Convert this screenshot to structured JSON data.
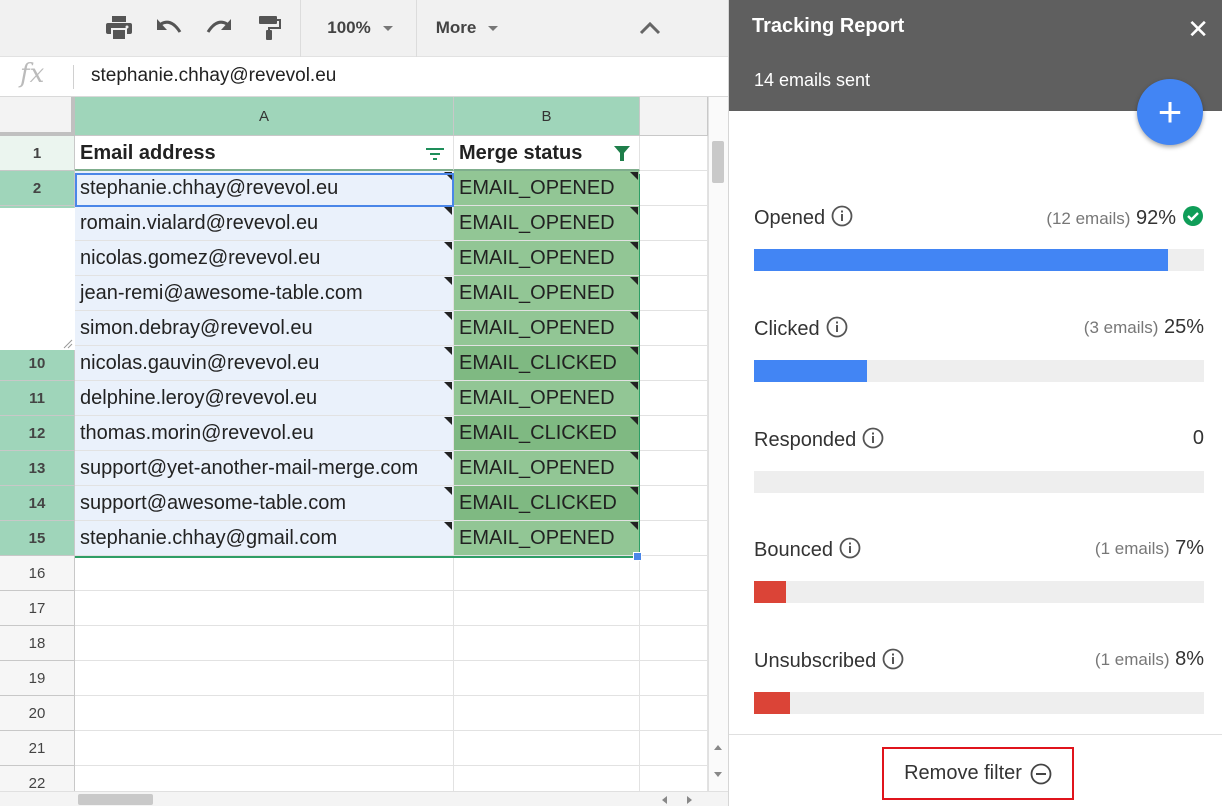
{
  "toolbar": {
    "zoom": "100%",
    "more_label": "More"
  },
  "formula": {
    "fx_label": "fx",
    "value": "stephanie.chhay@revevol.eu"
  },
  "sheet": {
    "columns": [
      "A",
      "B"
    ],
    "header": {
      "row_number": "1",
      "email_header": "Email address",
      "status_header": "Merge status"
    },
    "rows": [
      {
        "num": "2",
        "email": "stephanie.chhay@revevol.eu",
        "status": "EMAIL_OPENED"
      },
      {
        "num": "",
        "email": "romain.vialard@revevol.eu",
        "status": "EMAIL_OPENED"
      },
      {
        "num": "",
        "email": "nicolas.gomez@revevol.eu",
        "status": "EMAIL_OPENED"
      },
      {
        "num": "",
        "email": "jean-remi@awesome-table.com",
        "status": "EMAIL_OPENED"
      },
      {
        "num": "",
        "email": "simon.debray@revevol.eu",
        "status": "EMAIL_OPENED"
      },
      {
        "num": "10",
        "email": "nicolas.gauvin@revevol.eu",
        "status": "EMAIL_CLICKED"
      },
      {
        "num": "11",
        "email": "delphine.leroy@revevol.eu",
        "status": "EMAIL_OPENED"
      },
      {
        "num": "12",
        "email": "thomas.morin@revevol.eu",
        "status": "EMAIL_CLICKED"
      },
      {
        "num": "13",
        "email": "support@yet-another-mail-merge.com",
        "status": "EMAIL_OPENED"
      },
      {
        "num": "14",
        "email": "support@awesome-table.com",
        "status": "EMAIL_CLICKED"
      },
      {
        "num": "15",
        "email": "stephanie.chhay@gmail.com",
        "status": "EMAIL_OPENED"
      }
    ],
    "empty_rows": [
      "16",
      "17",
      "18",
      "19",
      "20",
      "21",
      "22"
    ]
  },
  "report": {
    "title": "Tracking Report",
    "close_glyph": "✕",
    "subtitle": "14 emails sent",
    "add_glyph": "+",
    "metrics": [
      {
        "label": "Opened",
        "count": "(12 emails)",
        "value": "92%",
        "fill": 0.92,
        "color": "#4285f4",
        "check": true
      },
      {
        "label": "Clicked",
        "count": "(3 emails)",
        "value": "25%",
        "fill": 0.25,
        "color": "#4285f4",
        "check": false
      },
      {
        "label": "Responded",
        "count": "",
        "value": "0",
        "fill": 0,
        "color": "#4285f4",
        "check": false
      },
      {
        "label": "Bounced",
        "count": "(1 emails)",
        "value": "7%",
        "fill": 0.07,
        "color": "#db4437",
        "check": false
      },
      {
        "label": "Unsubscribed",
        "count": "(1 emails)",
        "value": "8%",
        "fill": 0.08,
        "color": "#db4437",
        "check": false
      }
    ],
    "remove_filter_label": "Remove filter"
  },
  "colors": {
    "header_green": "#9fd5ba",
    "status_opened": "#92c695",
    "status_clicked": "#7fb982",
    "check_green": "#0f9d58"
  }
}
